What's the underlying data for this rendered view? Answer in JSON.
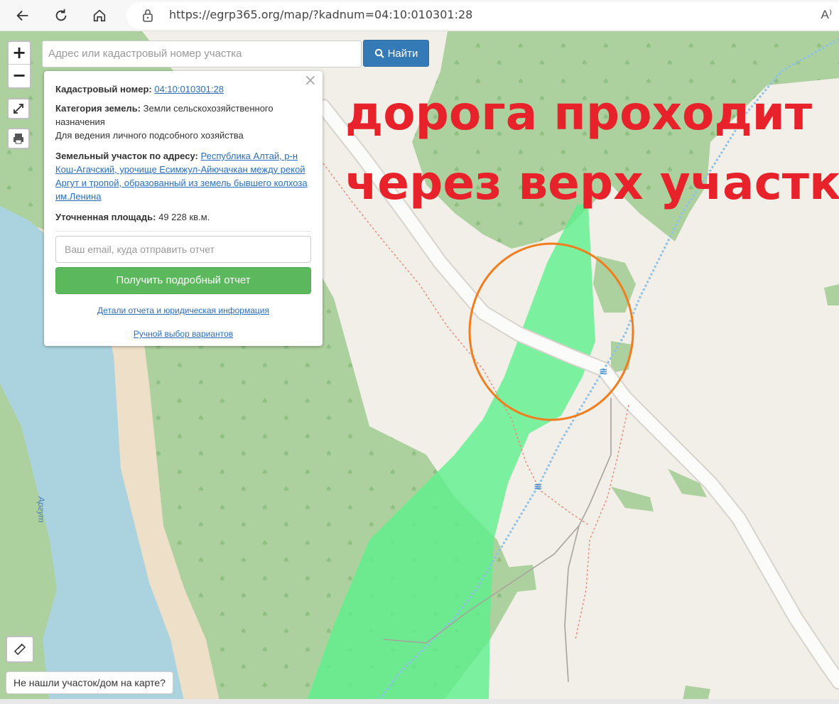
{
  "browser": {
    "url": "https://egrp365.org/map/?kadnum=04:10:010301:28",
    "read_aloud_label": "A⁾"
  },
  "search": {
    "placeholder": "Адрес или кадастровый номер участка",
    "button_label": "Найти"
  },
  "zoom": {
    "in_label": "+",
    "out_label": "−"
  },
  "popup": {
    "close_label": "×",
    "cadastral_label": "Кадастровый номер:",
    "cadastral_value": "04:10:010301:28",
    "category_label": "Категория земель:",
    "category_value": "Земли сельскохозяйственного назначения",
    "usage_value": "Для ведения личного подсобного хозяйства",
    "address_label": "Земельный участок по адресу:",
    "address_value": "Республика Алтай, р-н Кош-Агачский, урочище Есимжул-Айючачкан между рекой Аргут и тропой, образованный из земель бывшего колхоза им.Ленина",
    "area_label": "Уточненная площадь:",
    "area_value": "49 228 кв.м.",
    "email_placeholder": "Ваш email, куда отправить отчет",
    "report_button": "Получить подробный отчет",
    "details_link": "Детали отчета и юридическая информация",
    "manual_link": "Ручной выбор вариантов"
  },
  "annotation": {
    "line1": "дорога проходит",
    "line2": "через верх участка"
  },
  "map": {
    "river_label": "Аргут",
    "not_found_label": "Не нашли участок/дом на карте?"
  },
  "colors": {
    "annotation_text": "#e8222a",
    "circle": "#f07d1e",
    "parcel": "#5cf08c",
    "forest": "#add19e",
    "river": "#aad3df",
    "sand": "#eee0c8",
    "land": "#f2efe9",
    "primary_button": "#337ab7",
    "success_button": "#5cb85c"
  },
  "icons": {
    "back": "arrow-left-icon",
    "refresh": "refresh-icon",
    "home": "home-icon",
    "lock": "lock-icon",
    "search": "search-icon",
    "fullscreen": "expand-icon",
    "print": "printer-icon",
    "ruler": "ruler-icon"
  }
}
